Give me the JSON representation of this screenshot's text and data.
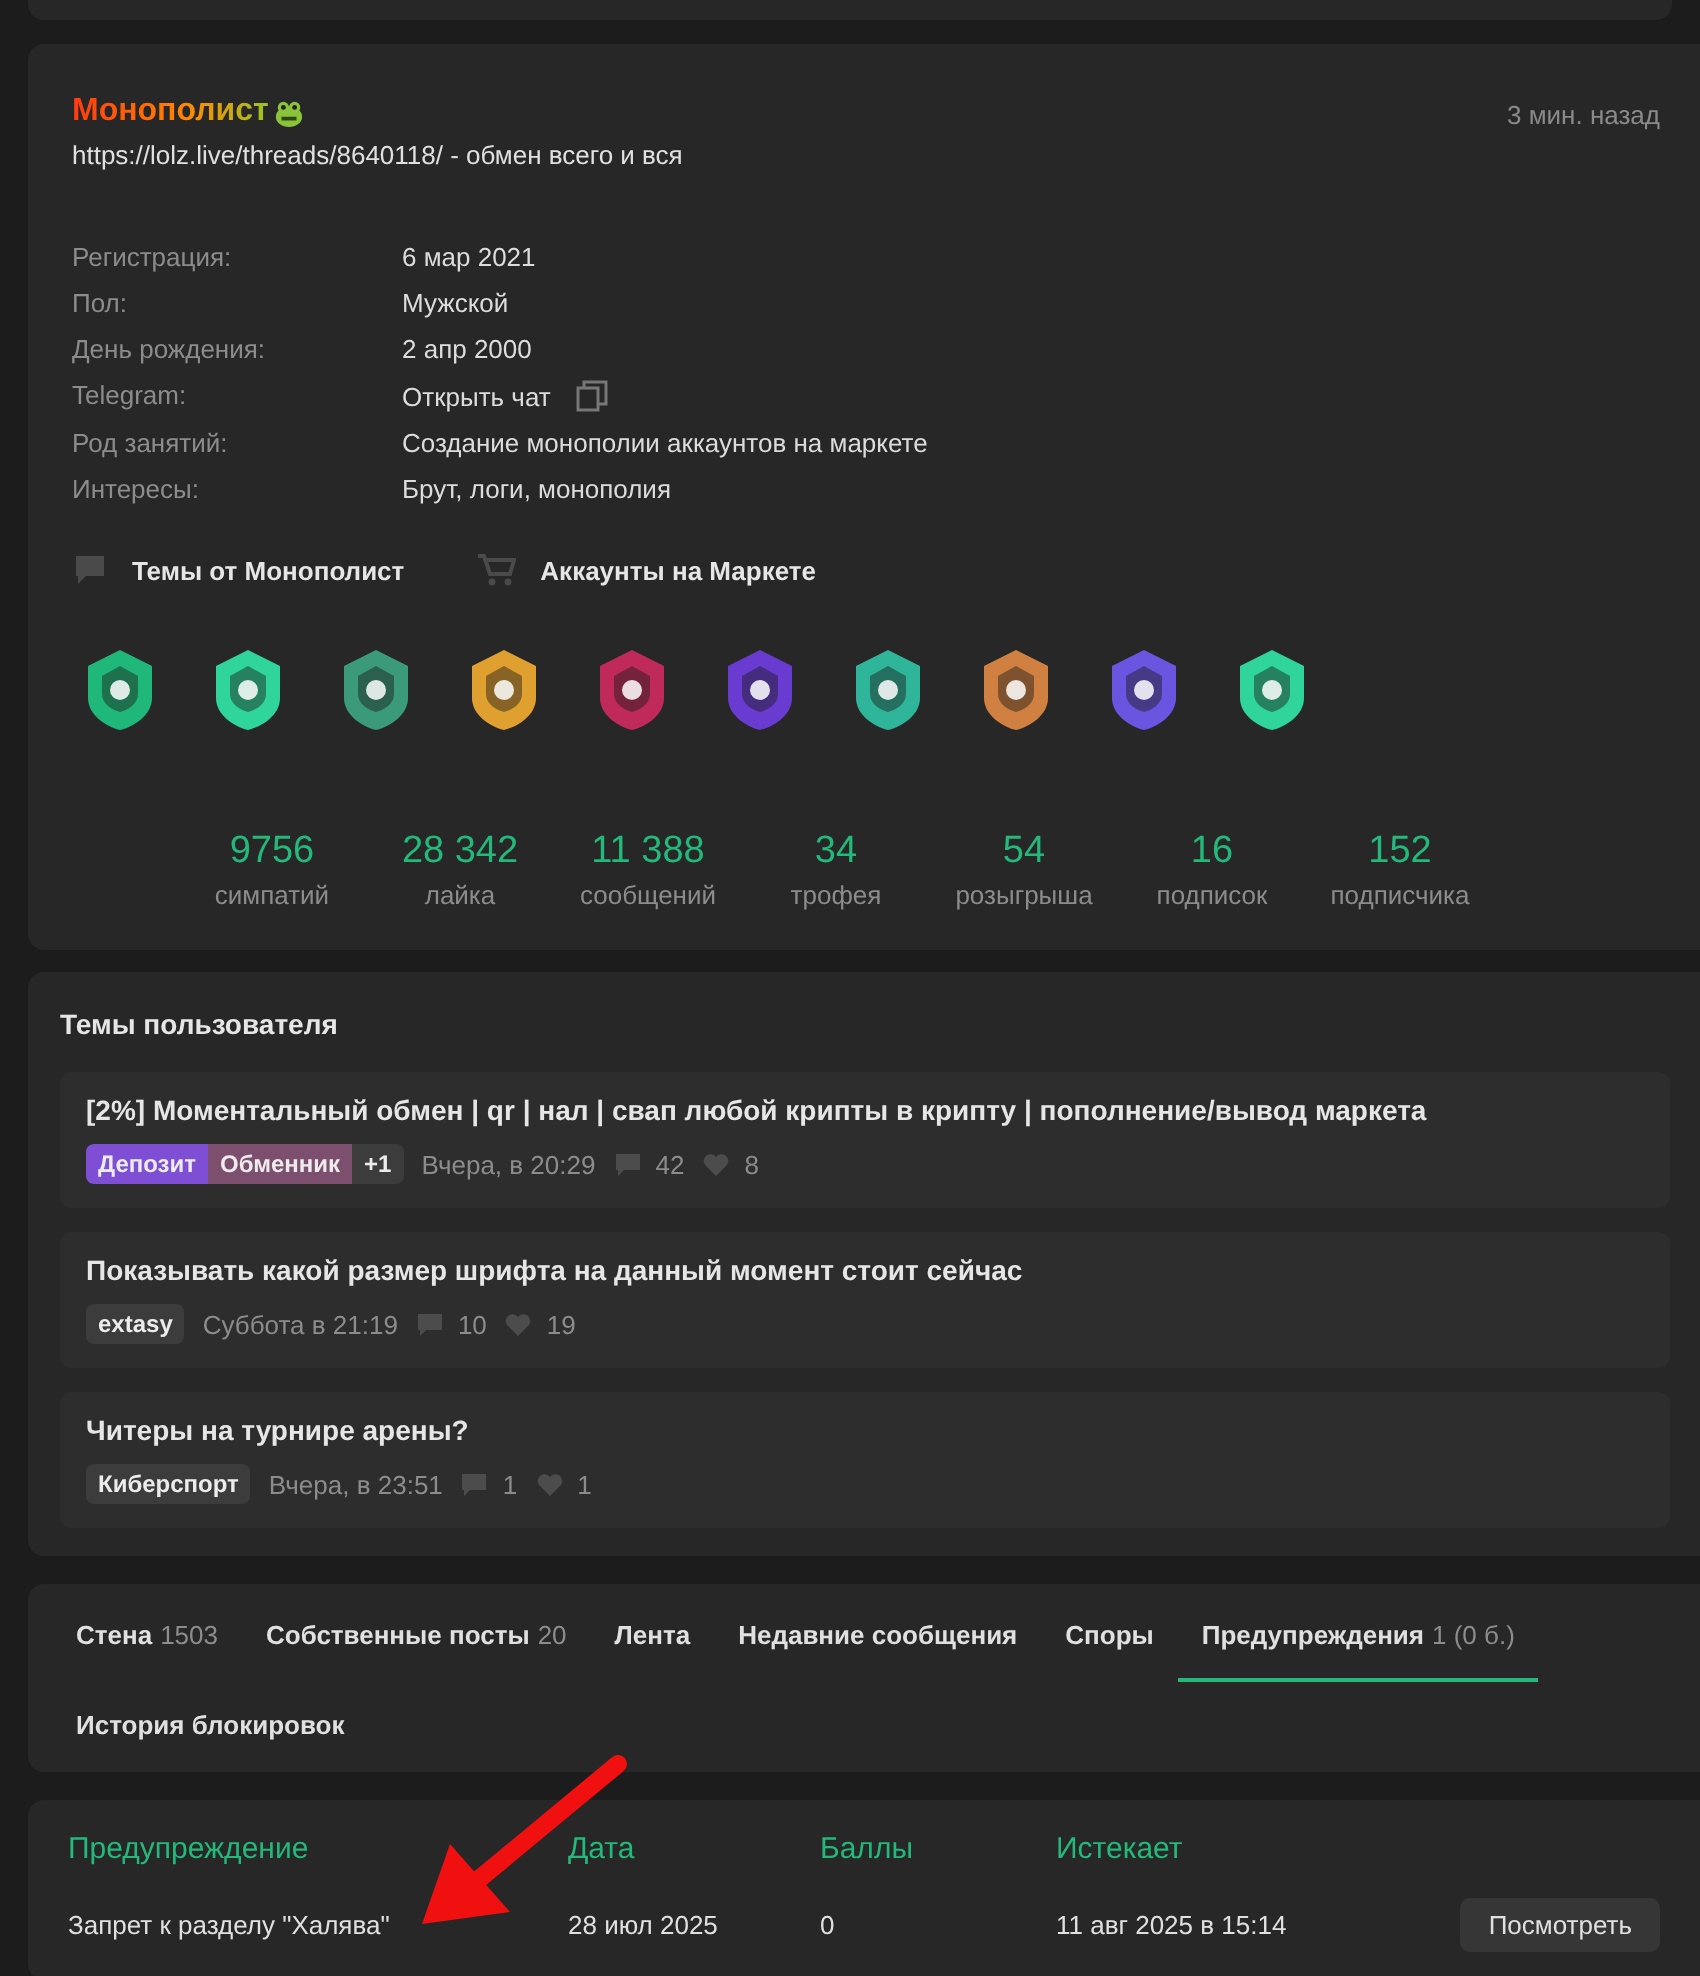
{
  "profile": {
    "username": "Монополист",
    "time": "3 мин. назад",
    "status": "https://lolz.live/threads/8640118/ - обмен всего и вся",
    "info": [
      {
        "label": "Регистрация:",
        "value": "6 мар 2021"
      },
      {
        "label": "Пол:",
        "value": "Мужской"
      },
      {
        "label": "День рождения:",
        "value": "2 апр 2000"
      },
      {
        "label": "Telegram:",
        "value": "Открыть чат",
        "kind": "link"
      },
      {
        "label": "Род занятий:",
        "value": "Создание монополии аккаунтов на маркете"
      },
      {
        "label": "Интересы:",
        "value": "Брут, логи, монополия"
      }
    ],
    "links": [
      {
        "label": "Темы от Монополист",
        "kind": "threads"
      },
      {
        "label": "Аккаунты на Маркете",
        "kind": "market"
      }
    ],
    "trophies": [
      {
        "color": "#1fb87a"
      },
      {
        "color": "#2fd59a"
      },
      {
        "color": "#3a9a7a"
      },
      {
        "color": "#e0a030"
      },
      {
        "color": "#c02a5a"
      },
      {
        "color": "#6a3bd0"
      },
      {
        "color": "#2fb59a"
      },
      {
        "color": "#d08040"
      },
      {
        "color": "#6a55e0"
      },
      {
        "color": "#2fd59a"
      }
    ],
    "stats": [
      {
        "value": "9756",
        "label": "симпатий"
      },
      {
        "value": "28 342",
        "label": "лайка"
      },
      {
        "value": "11 388",
        "label": "сообщений"
      },
      {
        "value": "34",
        "label": "трофея"
      },
      {
        "value": "54",
        "label": "розыгрыша"
      },
      {
        "value": "16",
        "label": "подписок"
      },
      {
        "value": "152",
        "label": "подписчика"
      }
    ]
  },
  "threads": {
    "title": "Темы пользователя",
    "items": [
      {
        "title": "[2%] Моментальный обмен | qr | нал | свап любой крипты в крипту | пополнение/вывод маркета",
        "tags": [
          {
            "label": "Депозит",
            "color": "#7e4fd4"
          },
          {
            "label": "Обменник",
            "color": "#7d4f6e"
          },
          {
            "label": "+1",
            "color": "#3c3c3c"
          }
        ],
        "date": "Вчера, в 20:29",
        "replies": "42",
        "likes": "8"
      },
      {
        "title": "Показывать какой размер шрифта на данный момент стоит сейчас",
        "tags": [
          {
            "label": "extasy",
            "color": "#3c3c3c"
          }
        ],
        "date": "Суббота в 21:19",
        "replies": "10",
        "likes": "19"
      },
      {
        "title": "Читеры на турнире арены?",
        "tags": [
          {
            "label": "Киберспорт",
            "color": "#3c3c3c"
          }
        ],
        "date": "Вчера, в 23:51",
        "replies": "1",
        "likes": "1"
      }
    ]
  },
  "tabs": [
    {
      "label": "Стена",
      "count": "1503",
      "selected": false
    },
    {
      "label": "Собственные посты",
      "count": "20",
      "selected": false
    },
    {
      "label": "Лента",
      "selected": false
    },
    {
      "label": "Недавние сообщения",
      "selected": false
    },
    {
      "label": "Споры",
      "selected": false
    },
    {
      "label": "Предупреждения",
      "count": "1 (0 б.)",
      "selected": true
    },
    {
      "label": "История блокировок",
      "selected": false
    }
  ],
  "warnings": {
    "columns": [
      "Предупреждение",
      "Дата",
      "Баллы",
      "Истекает"
    ],
    "rows": [
      {
        "cells": [
          "Запрет к разделу \"Халява\"",
          "28 июл 2025",
          "0",
          "11 авг 2025 в 15:14"
        ],
        "button": "Посмотреть"
      }
    ]
  }
}
